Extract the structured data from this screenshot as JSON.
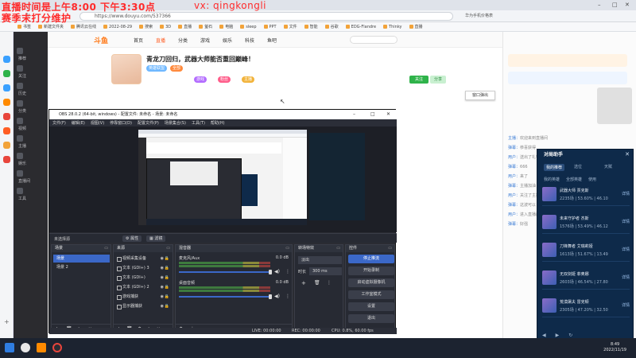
{
  "browser": {
    "url": "https://www.douyu.com/537366",
    "right_text": "华为手机价格表",
    "bookmarks": [
      "书签",
      "新建文件夹",
      "腾讯云在线",
      "2022-08-29",
      "搜索",
      "3D",
      "直播",
      "萤石",
      "电脑",
      "sleep",
      "PPT",
      "文件",
      "智能",
      "谷歌",
      "EDG-Flandre",
      "Thinky",
      "直播"
    ]
  },
  "overlay": {
    "line1": "直播时间是上午8:00  下午3:30点",
    "line2": "赛季末打分维护",
    "vx": "vx:  qingkongli"
  },
  "sidebar": {
    "items": [
      "推荐",
      "关注",
      "历史",
      "分类",
      "视频",
      "主播",
      "娱乐",
      "直播间",
      "工具"
    ]
  },
  "douyu": {
    "logo": "斗鱼",
    "nav": [
      "首页",
      "直播",
      "分类",
      "游戏",
      "娱乐",
      "科技",
      "鱼吧"
    ],
    "room_title": "青龙刀回归，武器大师能否重回巅峰！",
    "tags": [
      "英雄联盟",
      "全部",
      "游戏",
      "粉丝",
      "主播"
    ],
    "follow": "关注",
    "follow2": "分享",
    "exit_popup": "窗口弹出",
    "chat_lines": [
      [
        "主播",
        "欢迎来到直播间"
      ],
      [
        "弹幕",
        "恭喜获得"
      ],
      [
        "用户",
        "送出了礼物"
      ],
      [
        "弹幕",
        "666"
      ],
      [
        "用户",
        "来了"
      ],
      [
        "弹幕",
        "主播加油"
      ],
      [
        "用户",
        "关注了主播"
      ],
      [
        "弹幕",
        "这波可以"
      ],
      [
        "用户",
        "进入直播间"
      ],
      [
        "弹幕",
        "好强"
      ]
    ]
  },
  "obs": {
    "title": "OBS 28.0.2 (64-bit, windows) - 配置文件: 未命名 - 场景: 未命名",
    "menu": [
      "文件(F)",
      "编辑(E)",
      "视图(V)",
      "停靠窗口(D)",
      "配置文件(P)",
      "场景集合(S)",
      "工具(T)",
      "帮助(H)"
    ],
    "status_bar_label": "未选择源",
    "props_btn": "属性",
    "filters_btn": "滤镜",
    "docks": {
      "scenes": "场景",
      "sources": "来源",
      "mixer": "混音器",
      "transitions": "转场特效",
      "controls": "控件"
    },
    "scenes": [
      "场景",
      "场景 2"
    ],
    "sources": [
      "视频采集设备",
      "文本 (GDI+) 3",
      "文本 (GDI+)",
      "文本 (GDI+) 2",
      "游戏捕获",
      "显示器捕获"
    ],
    "mixer": [
      {
        "name": "麦克风/Aux",
        "db": "0.0 dB"
      },
      {
        "name": "桌面音频",
        "db": "0.0 dB"
      }
    ],
    "transition": {
      "type": "淡出",
      "duration_label": "时长",
      "duration": "300 ms"
    },
    "controls": [
      "停止推流",
      "开始录制",
      "启动虚拟摄像机",
      "工作室模式",
      "设置",
      "退出"
    ],
    "status": {
      "live": "LIVE: 00:00:00",
      "rec": "REC: 00:00:00",
      "cpu": "CPU: 0.8%, 60.00 fps"
    }
  },
  "assistant": {
    "title": "对局助手",
    "tabs": [
      "我的推荐",
      "选位",
      "天赋"
    ],
    "subtabs": [
      "我的英雄",
      "全部英雄",
      "使用"
    ],
    "champs": [
      {
        "name": "武器大师 贾克斯",
        "stat": "2235场 | 53.60% | 46.10",
        "btn": "详情"
      },
      {
        "name": "未来守护者 杰斯",
        "stat": "1576场 | 53.49% | 46.12",
        "btn": "详情"
      },
      {
        "name": "刀锋舞者 艾瑞莉娅",
        "stat": "1613场 | 51.67% | 13.49",
        "btn": "详情"
      },
      {
        "name": "无双剑姬 菲奥娜",
        "stat": "2603场 | 46.54% | 27.80",
        "btn": "详情"
      },
      {
        "name": "荒漠屠夫 雷克顿",
        "stat": "2305场 | 47.20% | 32.50",
        "btn": "详情"
      }
    ]
  },
  "taskbar": {
    "time": "8:49",
    "date": "2022/11/19"
  }
}
